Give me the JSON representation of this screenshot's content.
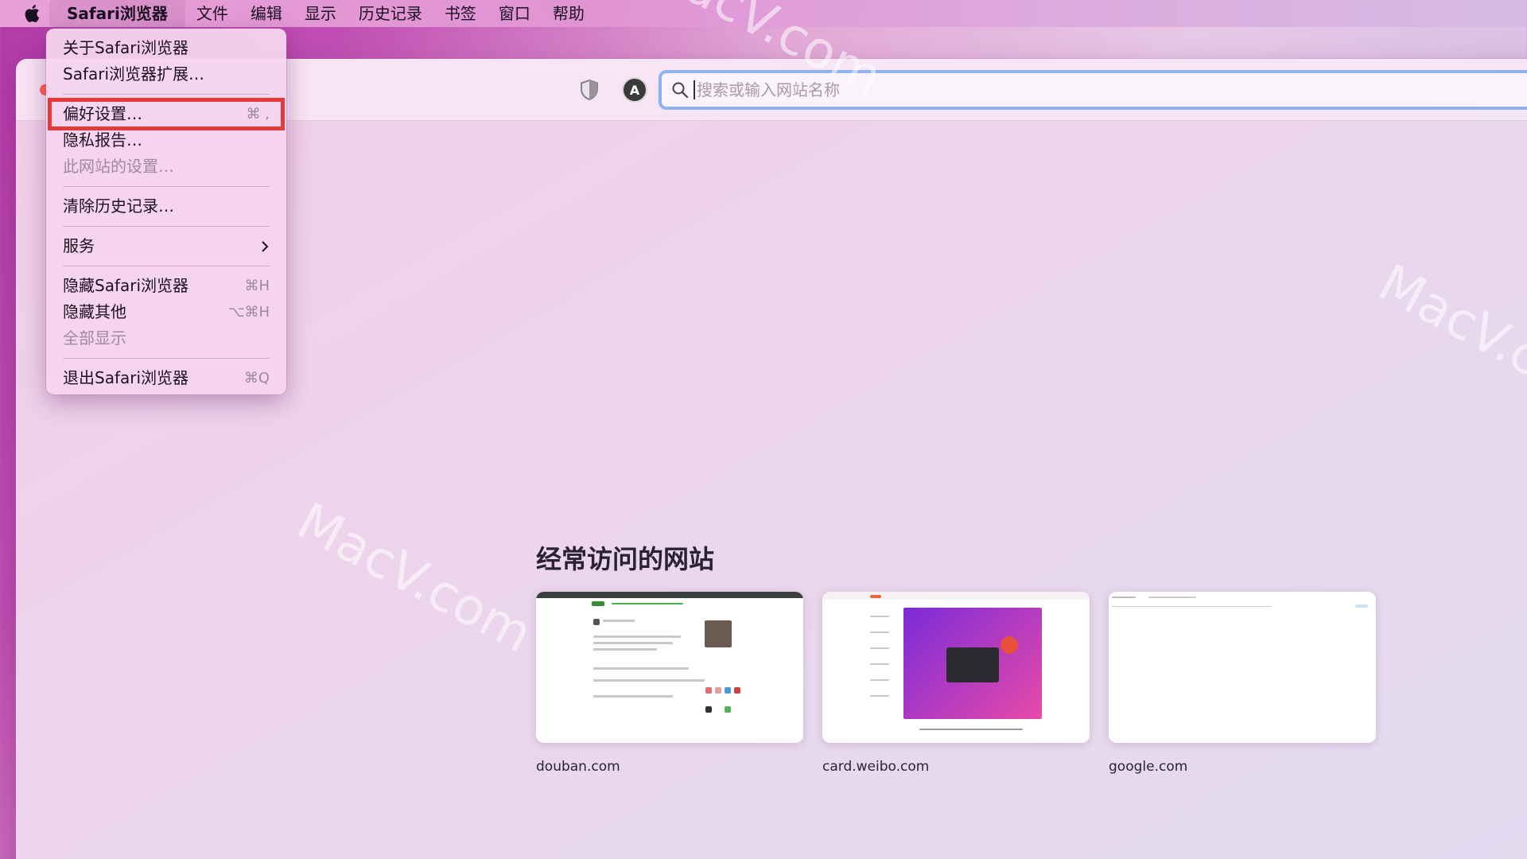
{
  "menubar": {
    "apple_icon": "apple-logo-icon",
    "items": [
      "Safari浏览器",
      "文件",
      "编辑",
      "显示",
      "历史记录",
      "书签",
      "窗口",
      "帮助"
    ]
  },
  "safari_menu": {
    "about": "关于Safari浏览器",
    "extensions": "Safari浏览器扩展…",
    "preferences": "偏好设置…",
    "preferences_shortcut": "⌘ ,",
    "privacy_report": "隐私报告…",
    "site_settings": "此网站的设置…",
    "clear_history": "清除历史记录…",
    "services": "服务",
    "hide_safari": "隐藏Safari浏览器",
    "hide_safari_shortcut": "⌘H",
    "hide_others": "隐藏其他",
    "hide_others_shortcut": "⌥⌘H",
    "show_all": "全部显示",
    "quit": "退出Safari浏览器",
    "quit_shortcut": "⌘Q"
  },
  "toolbar": {
    "address_placeholder": "搜索或输入网站名称",
    "account_initial": "A"
  },
  "frequently_visited": {
    "title": "经常访问的网站",
    "sites": [
      {
        "label": "douban.com"
      },
      {
        "label": "card.weibo.com"
      },
      {
        "label": "google.com"
      }
    ]
  },
  "watermark": "MacV.com",
  "colors": {
    "highlight_border": "#e23b3b",
    "address_focus": "#8fb2ec",
    "weibo_gradient_start": "#7a2bd8",
    "weibo_gradient_end": "#e84aa8"
  }
}
